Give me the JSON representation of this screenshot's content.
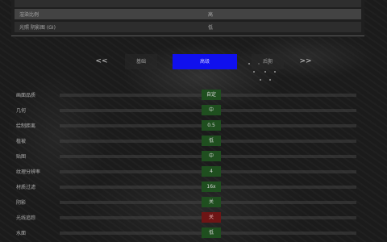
{
  "top_settings": [
    {
      "label": "",
      "value": ""
    },
    {
      "label": "渲染比例",
      "value": "高"
    },
    {
      "label": "光照 阴影图 (GI)",
      "value": "低"
    }
  ],
  "nav": {
    "prev": "<<",
    "next": ">>",
    "tabs": [
      {
        "label": "基础"
      },
      {
        "label": "高级"
      },
      {
        "label": "后期"
      }
    ]
  },
  "settings": [
    {
      "label": "画面品质",
      "value": "自定",
      "state": "on"
    },
    {
      "label": "几何",
      "value": "中",
      "state": "on"
    },
    {
      "label": "绘制距离",
      "value": "0.5",
      "state": "on"
    },
    {
      "label": "植被",
      "value": "低",
      "state": "on"
    },
    {
      "label": "贴图",
      "value": "中",
      "state": "on"
    },
    {
      "label": "纹理分辨率",
      "value": "4",
      "state": "on"
    },
    {
      "label": "材质过滤",
      "value": "16x",
      "state": "on"
    },
    {
      "label": "阴影",
      "value": "关",
      "state": "on"
    },
    {
      "label": "光线追踪",
      "value": "关",
      "state": "off"
    },
    {
      "label": "水面",
      "value": "低",
      "state": "on"
    }
  ],
  "colors": {
    "active_tab": "#1010ee",
    "value_on": "#1f4f1f",
    "value_off": "#6e1515"
  }
}
